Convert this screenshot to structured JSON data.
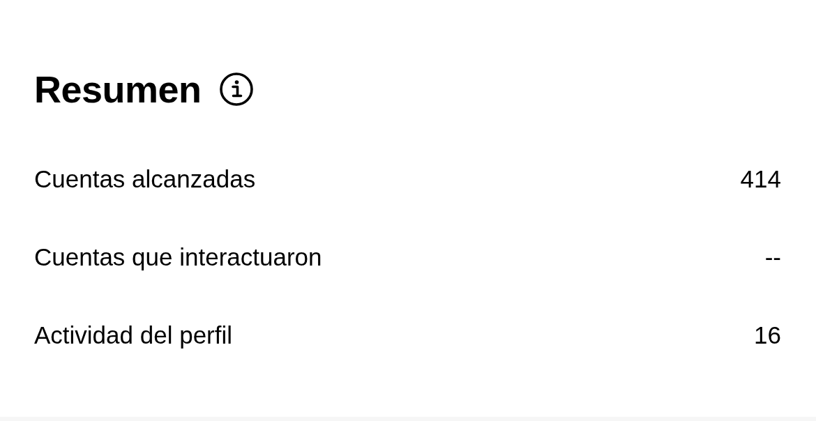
{
  "summary": {
    "title": "Resumen",
    "rows": [
      {
        "label": "Cuentas alcanzadas",
        "value": "414"
      },
      {
        "label": "Cuentas que interactuaron",
        "value": "--"
      },
      {
        "label": "Actividad del perfil",
        "value": "16"
      }
    ]
  }
}
